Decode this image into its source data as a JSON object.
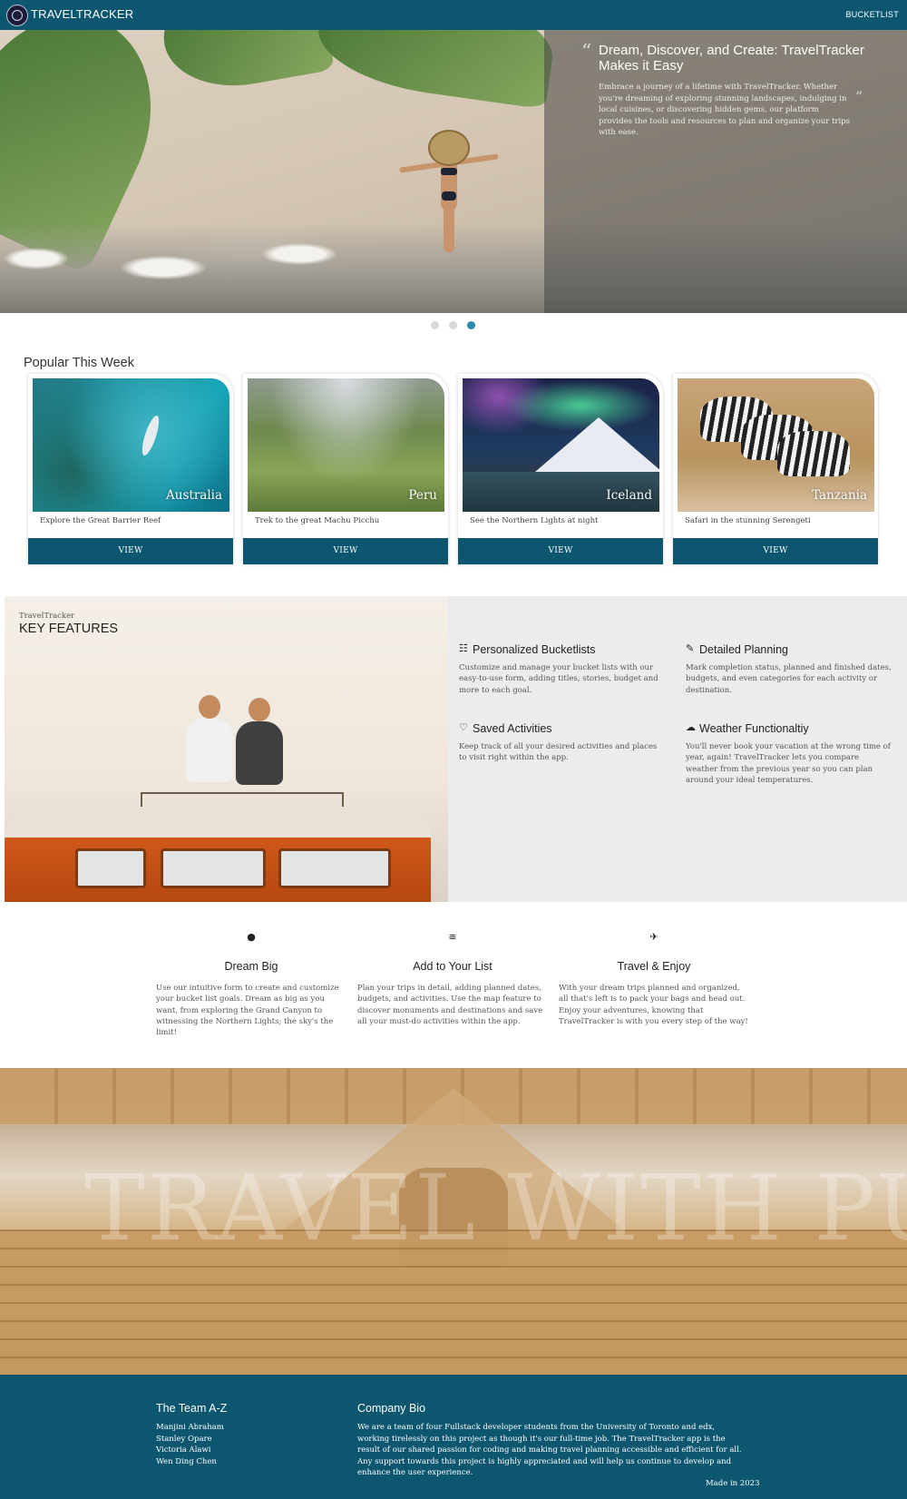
{
  "nav": {
    "brand": "TRAVELTRACKER",
    "link": "BUCKETLIST"
  },
  "hero": {
    "title": "Dream, Discover, and Create: TravelTracker Makes it Easy",
    "text": "Embrace a journey of a lifetime with TravelTracker. Whether you're dreaming of exploring stunning landscapes, indulging in local cuisines, or discovering hidden gems, our platform provides the tools and resources to plan and organize your trips with ease.",
    "open_quote": "“",
    "close_quote": "”",
    "slides": 3,
    "active_slide": 3
  },
  "popular": {
    "title": "Popular This Week",
    "cards": [
      {
        "country": "Australia",
        "desc": "Explore the Great Barrier Reef",
        "button": "VIEW"
      },
      {
        "country": "Peru",
        "desc": "Trek to the great Machu Picchu",
        "button": "VIEW"
      },
      {
        "country": "Iceland",
        "desc": "See the Northern Lights at night",
        "button": "VIEW"
      },
      {
        "country": "Tanzania",
        "desc": "Safari in the stunning Serengeti",
        "button": "VIEW"
      }
    ]
  },
  "features": {
    "kicker": "TravelTracker",
    "heading": "KEY FEATURES",
    "items": [
      {
        "icon": "checklist-icon",
        "title": "Personalized Bucketlists",
        "desc": "Customize and manage your bucket lists with our easy-to-use form, adding titles, stories, budget and more to each goal."
      },
      {
        "icon": "edit-note-icon",
        "title": "Detailed Planning",
        "desc": "Mark completion status, planned and finished dates, budgets, and even categories for each activity or destination."
      },
      {
        "icon": "heart-icon",
        "title": "Saved Activities",
        "desc": "Keep track of all your desired activities and places to visit right within the app."
      },
      {
        "icon": "weather-icon",
        "title": "Weather Functionaltiy",
        "desc": "You'll never book your vacation at the wrong time of year, again! TravelTracker lets you compare weather from the previous year so you can plan around your ideal temperatures."
      }
    ]
  },
  "steps": [
    {
      "icon": "compass-icon",
      "title": "Dream Big",
      "desc": "Use our intuitive form to create and customize your bucket list goals. Dream as big as you want, from exploring the Grand Canyon to witnessing the Northern Lights; the sky's the limit!"
    },
    {
      "icon": "playlist-add-icon",
      "title": "Add to Your List",
      "desc": "Plan your trips in detail, adding planned dates, budgets, and activities. Use the map feature to discover monuments and destinations and save all your must-do activities within the app."
    },
    {
      "icon": "flight-takeoff-icon",
      "title": "Travel & Enjoy",
      "desc": "With your dream trips planned and organized, all that's left is to pack your bags and head out. Enjoy your adventures, knowing that TravelTracker is with you every step of the way!"
    }
  ],
  "banner": {
    "text": "TRAVEL WITH PU"
  },
  "footer": {
    "team_title": "The Team A-Z",
    "team": [
      "Manjini Abraham",
      "Stanley Opare",
      "Victoria Alawi",
      "Wen Ding Chen"
    ],
    "bio_title": "Company Bio",
    "bio": "We are a team of four Fullstack developer students from the University of Toronto and edx, working tirelessly on this project as though it's our full-time job. The TravelTracker app is the result of our shared passion for coding and making travel planning accessible and efficient for all. Any support towards this project is highly appreciated and will help us continue to develop and enhance the user experience.",
    "made": "Made in 2023"
  },
  "colors": {
    "primary": "#0d5670",
    "dot_active": "#2a8aa8",
    "features_bg": "#ececec"
  }
}
